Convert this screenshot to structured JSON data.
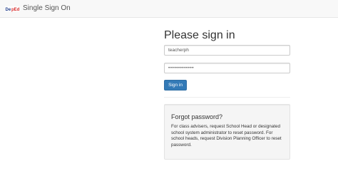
{
  "navbar": {
    "brand_title": "Single Sign On",
    "logo_icon": "deped-logo-icon"
  },
  "login": {
    "heading": "Please sign in",
    "username_value": "teacherph",
    "password_value": "•••••••••••••",
    "signin_label": "Sign in"
  },
  "forgot": {
    "title": "Forgot password?",
    "body": "For class advisers, request School Head or designated school system administrator to reset password. For school heads, request Division Planning Officer to reset password."
  },
  "colors": {
    "primary": "#337ab7",
    "navbar_bg": "#f8f8f8",
    "well_bg": "#f5f5f5"
  }
}
